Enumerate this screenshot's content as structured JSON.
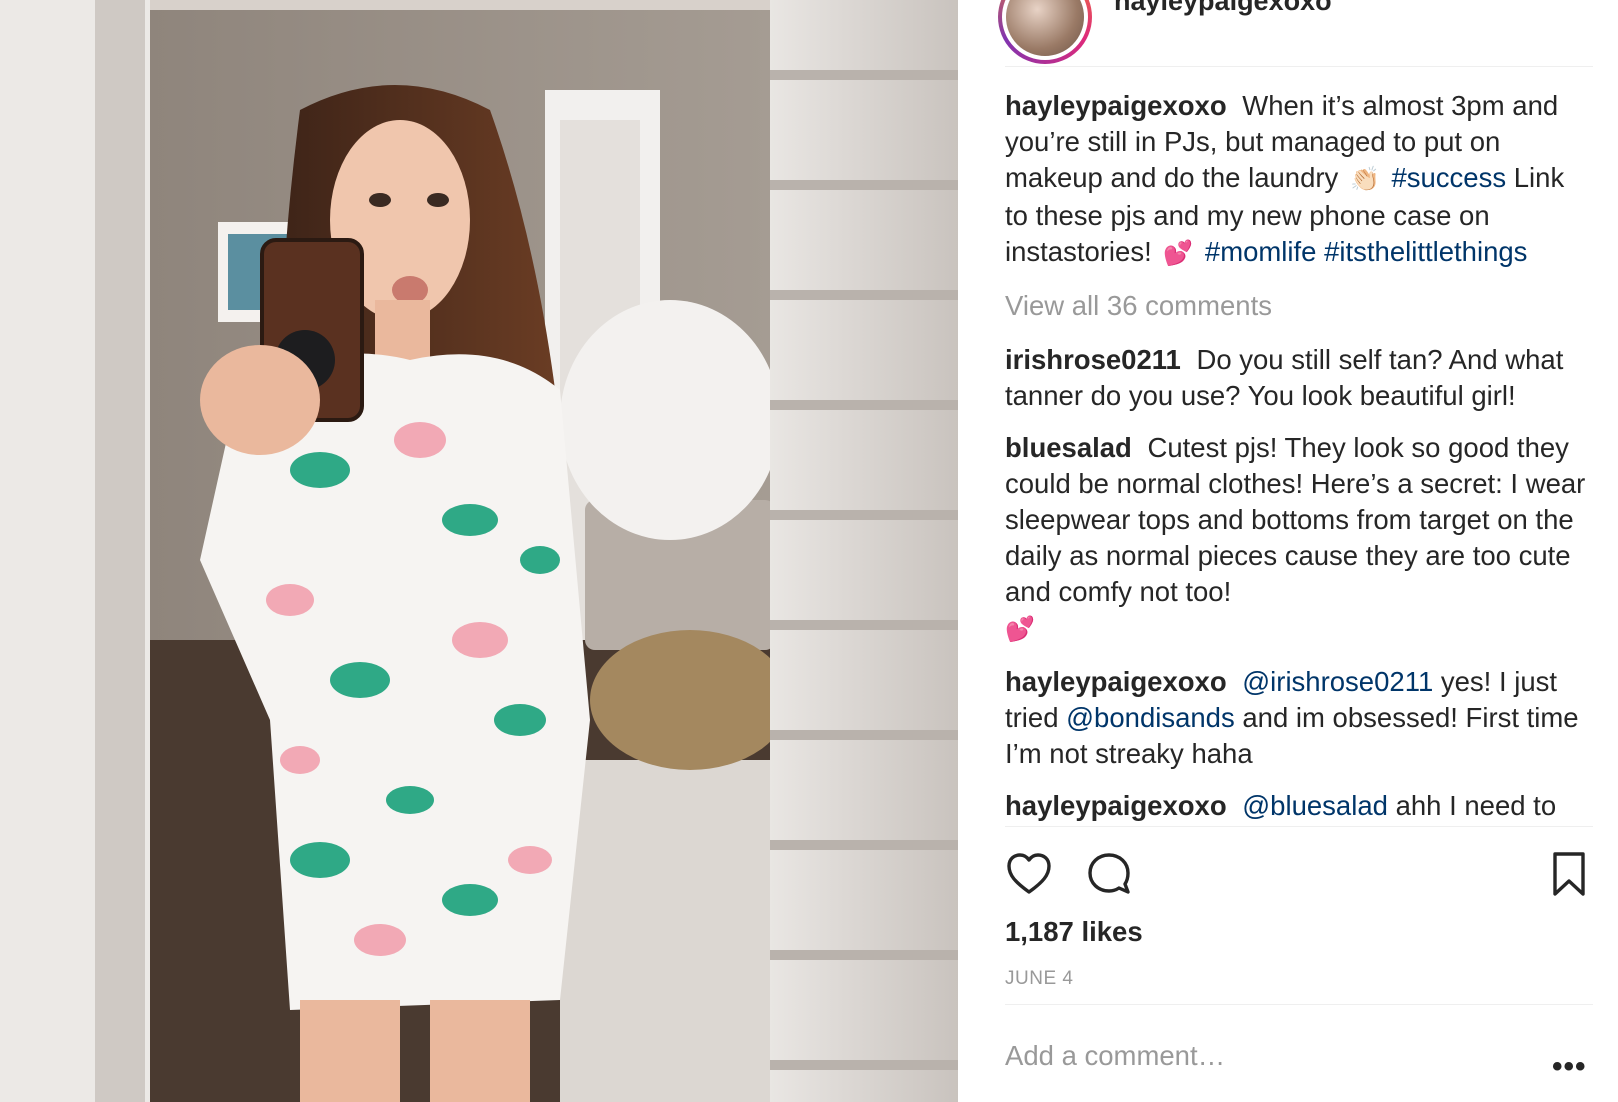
{
  "post": {
    "username": "hayleypaigexoxo",
    "caption_parts": [
      {
        "text": "When it’s almost 3pm and you’re still in PJs, but managed to put on makeup and do the laundry",
        "kind": "text"
      },
      {
        "text": "👏🏻",
        "kind": "emoji"
      },
      {
        "text": "#success",
        "kind": "tag"
      },
      {
        "text": "Link to these pjs and my new phone case on instastories!",
        "kind": "text"
      },
      {
        "text": "💕",
        "kind": "emoji"
      },
      {
        "text": "#momlife",
        "kind": "tag"
      },
      {
        "text": "#itsthelittlethings",
        "kind": "tag"
      }
    ],
    "view_all_label": "View all 36 comments",
    "likes_label": "1,187 likes",
    "date_label": "JUNE 4",
    "add_comment_placeholder": "Add a comment…",
    "more_label": "•••"
  },
  "comments": [
    {
      "username": "irishrose0211",
      "text": "Do you still self tan? And what tanner do you use? You look beautiful girl!"
    },
    {
      "username": "bluesalad",
      "text": "Cutest pjs! They look so good they could be normal clothes! Here’s a secret: I wear sleepwear tops and bottoms from target on the daily as normal pieces cause they are too cute and comfy not too!",
      "emoji": "💕"
    },
    {
      "username": "hayleypaigexoxo",
      "mention": "@irishrose0211",
      "text_a": "yes! I just tried",
      "mention2": "@bondisands",
      "text_b": "and im obsessed! First time I’m not streaky haha"
    },
    {
      "username": "hayleypaigexoxo",
      "mention": "@bluesalad",
      "text": "ahh I need to"
    }
  ],
  "icons": {
    "like": "heart-icon",
    "comment": "speech-bubble-icon",
    "save": "bookmark-icon",
    "more": "ellipsis-icon"
  },
  "colors": {
    "text": "#262626",
    "muted": "#999999",
    "hashtag": "#003569",
    "divider": "#efefef"
  }
}
